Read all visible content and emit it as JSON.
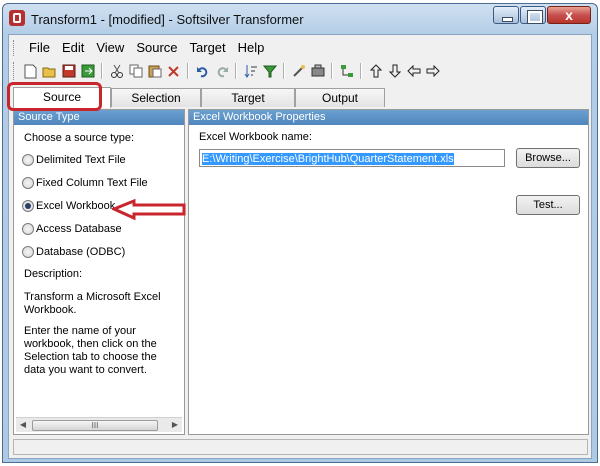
{
  "window": {
    "title": "Transform1 - [modified] - Softsilver Transformer",
    "close_glyph": "x"
  },
  "menu": [
    "File",
    "Edit",
    "View",
    "Source",
    "Target",
    "Help"
  ],
  "toolbar_icons": [
    "new-icon",
    "open-icon",
    "save-icon",
    "export-icon",
    "cut-icon",
    "copy-icon",
    "paste-icon",
    "delete-icon",
    "undo-icon",
    "redo-icon",
    "sort-icon",
    "filter-icon",
    "wizard-icon",
    "settings-icon",
    "hierarchy-icon",
    "up-arrow-icon",
    "down-arrow-icon",
    "left-arrow-icon",
    "right-arrow-icon"
  ],
  "tabs": [
    "Source",
    "Selection",
    "Target",
    "Output"
  ],
  "left_pane": {
    "header": "Source Type",
    "prompt": "Choose a source type:",
    "options": [
      {
        "label": "Delimited Text File",
        "checked": false
      },
      {
        "label": "Fixed Column Text File",
        "checked": false
      },
      {
        "label": "Excel Workbook",
        "checked": true
      },
      {
        "label": "Access Database",
        "checked": false
      },
      {
        "label": "Database (ODBC)",
        "checked": false
      }
    ],
    "description_label": "Description:",
    "description_1": "Transform a Microsoft Excel Workbook.",
    "description_2": "Enter the name of your workbook, then click on the Selection tab to choose the data you want to convert.",
    "scroll_thumb": "III"
  },
  "right_pane": {
    "header": "Excel Workbook Properties",
    "field_label": "Excel Workbook name:",
    "field_value": "E:\\Writing\\Exercise\\BrightHub\\QuarterStatement.xls",
    "browse_label": "Browse...",
    "test_label": "Test..."
  },
  "colors": {
    "annotation_red": "#c9252c",
    "header_blue": "#4f86bd"
  }
}
